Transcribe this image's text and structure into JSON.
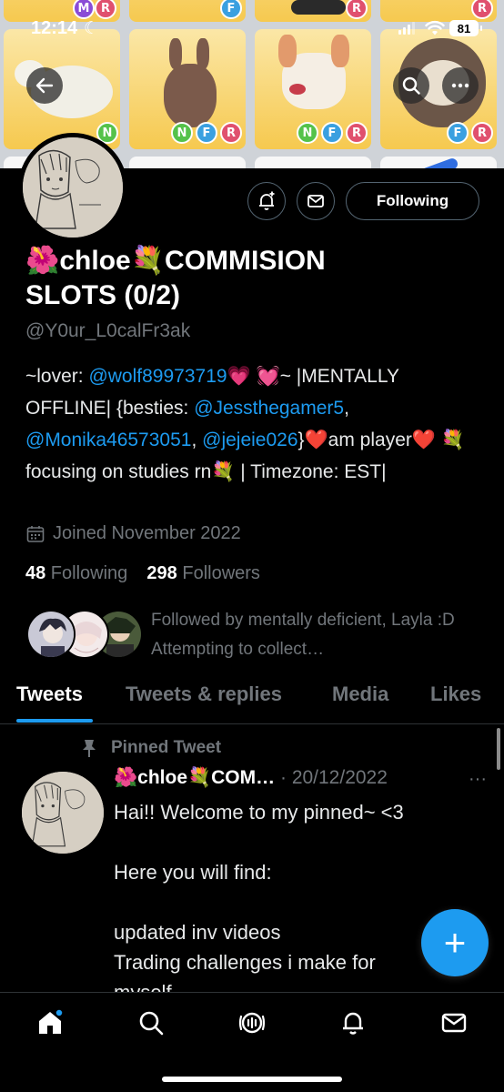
{
  "status_bar": {
    "time": "12:14",
    "moon": "☾",
    "battery": "81"
  },
  "banner_badges": {
    "n": "N",
    "f": "F",
    "r": "R",
    "m": "M"
  },
  "profile": {
    "name_line1": "🌺chloe💐COMMISION",
    "name_line2": "SLOTS (0/2)",
    "handle": "@Y0ur_L0calFr3ak",
    "following_button": "Following",
    "bio": {
      "t1": "~lover: ",
      "l1": "@wolf89973719",
      "t2": "💗 💓~ |MENTALLY OFFLINE| {besties: ",
      "l2": "@Jessthegamer5",
      "t3": ", ",
      "l3": "@Monika46573051",
      "t4": ", ",
      "l4": "@jejeie026",
      "t5": "}❤️am player❤️ 💐focusing on studies rn💐 | Timezone: EST|"
    },
    "joined": "Joined November 2022",
    "following_count": "48",
    "following_label": " Following",
    "followers_count": "298",
    "followers_label": " Followers",
    "followed_by": "Followed by mentally deficient, Layla :D Attempting to collect…"
  },
  "tabs": [
    "Tweets",
    "Tweets & replies",
    "Media",
    "Likes"
  ],
  "pinned_tweet": {
    "label": "Pinned Tweet",
    "author": "🌺chloe💐COM…",
    "sep": " · ",
    "date": "20/12/2022",
    "more": "···",
    "lines": [
      "Hai!! Welcome to my pinned~ <3",
      "",
      "Here you will find:",
      "",
      "updated inv videos",
      "Trading challenges i make for",
      "myself"
    ]
  },
  "fab_label": "+",
  "colors": {
    "accent": "#1d9bf0",
    "muted": "#71767b",
    "background": "#000000"
  }
}
